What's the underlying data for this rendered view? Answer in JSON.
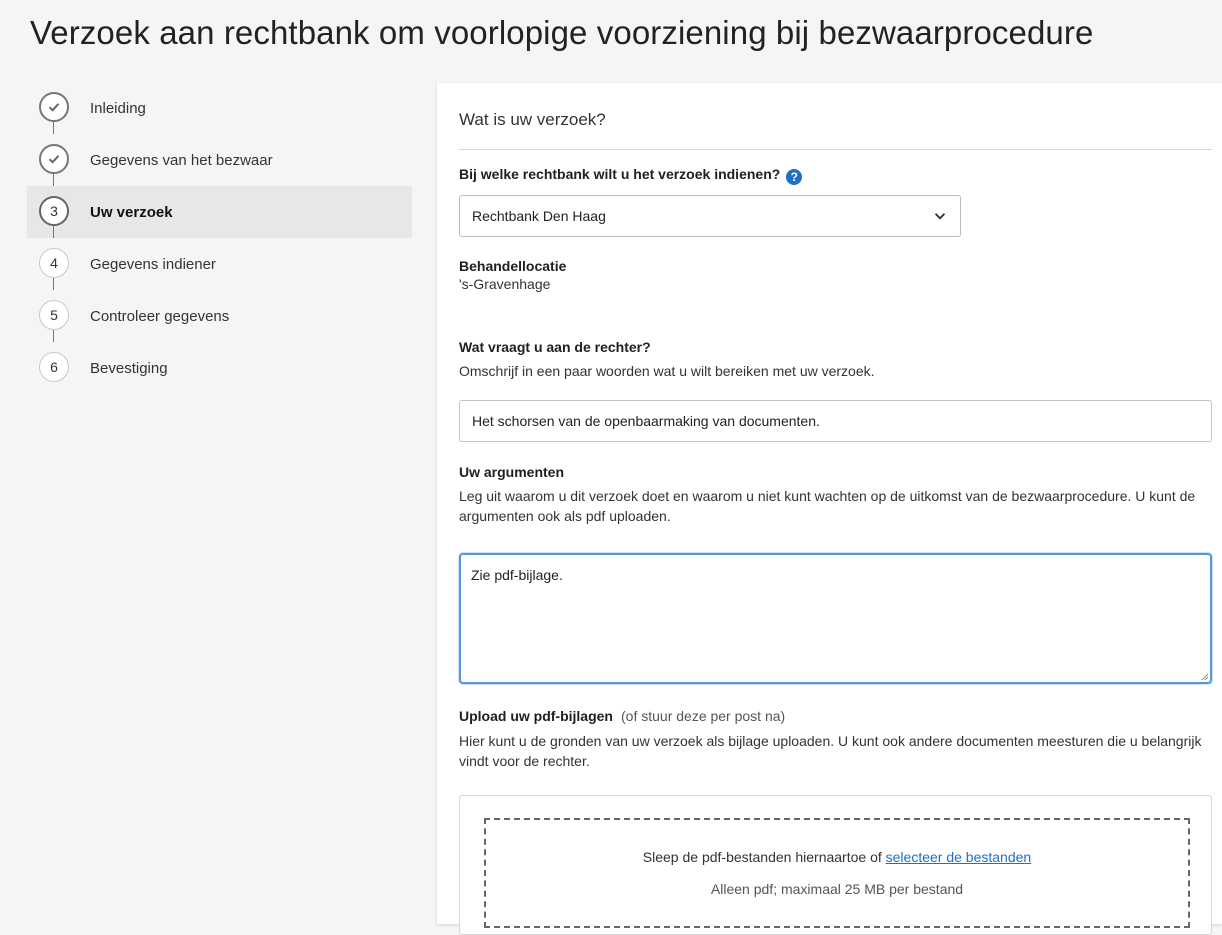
{
  "page": {
    "title": "Verzoek aan rechtbank om voorlopige voorziening bij bezwaarprocedure"
  },
  "stepper": {
    "steps": [
      {
        "number": "1",
        "label": "Inleiding",
        "state": "done"
      },
      {
        "number": "2",
        "label": "Gegevens van het bezwaar",
        "state": "done"
      },
      {
        "number": "3",
        "label": "Uw verzoek",
        "state": "active"
      },
      {
        "number": "4",
        "label": "Gegevens indiener",
        "state": "todo"
      },
      {
        "number": "5",
        "label": "Controleer gegevens",
        "state": "todo"
      },
      {
        "number": "6",
        "label": "Bevestiging",
        "state": "todo"
      }
    ]
  },
  "form": {
    "section_title": "Wat is uw verzoek?",
    "court": {
      "label": "Bij welke rechtbank wilt u het verzoek indienen?",
      "help_icon": "?",
      "selected": "Rechtbank Den Haag"
    },
    "location": {
      "label": "Behandellocatie",
      "value": "'s-Gravenhage"
    },
    "request": {
      "label": "Wat vraagt u aan de rechter?",
      "description": "Omschrijf in een paar woorden wat u wilt bereiken met uw verzoek.",
      "value": "Het schorsen van de openbaarmaking van documenten."
    },
    "arguments": {
      "label": "Uw argumenten",
      "description": "Leg uit waarom u dit verzoek doet en waarom u niet kunt wachten op de uitkomst van de bezwaarprocedure. U kunt de argumenten ook als pdf uploaden.",
      "value": "Zie pdf-bijlage."
    },
    "upload": {
      "label": "Upload uw pdf-bijlagen",
      "label_note": "(of stuur deze per post na)",
      "description": "Hier kunt u de gronden van uw verzoek als bijlage uploaden. U kunt ook andere documenten meesturen die u belangrijk vindt voor de rechter.",
      "drop_text": "Sleep de pdf-bestanden hiernaartoe of",
      "drop_link": "selecteer de bestanden",
      "hint": "Alleen pdf; maximaal 25 MB per bestand"
    }
  },
  "colors": {
    "accent": "#1f6fc6",
    "focus_border": "#5b95d6",
    "background": "#f5f5f5"
  }
}
